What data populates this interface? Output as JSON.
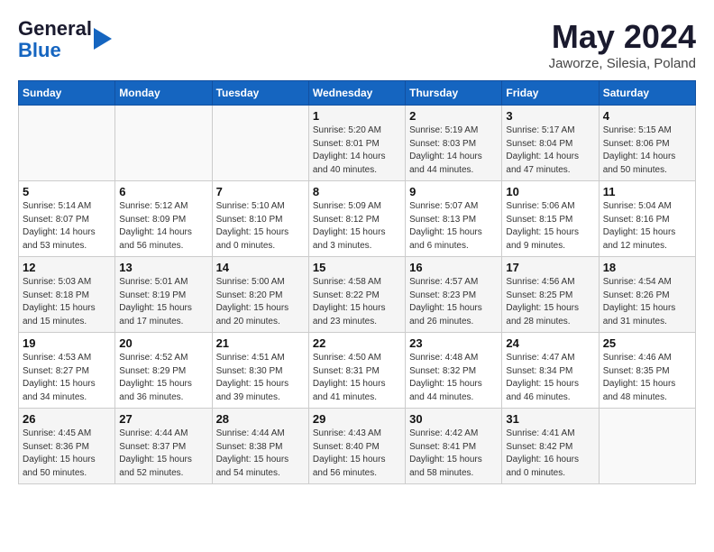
{
  "header": {
    "logo_general": "General",
    "logo_blue": "Blue",
    "month_year": "May 2024",
    "location": "Jaworze, Silesia, Poland"
  },
  "days_of_week": [
    "Sunday",
    "Monday",
    "Tuesday",
    "Wednesday",
    "Thursday",
    "Friday",
    "Saturday"
  ],
  "weeks": [
    [
      {
        "day": "",
        "info": ""
      },
      {
        "day": "",
        "info": ""
      },
      {
        "day": "",
        "info": ""
      },
      {
        "day": "1",
        "info": "Sunrise: 5:20 AM\nSunset: 8:01 PM\nDaylight: 14 hours\nand 40 minutes."
      },
      {
        "day": "2",
        "info": "Sunrise: 5:19 AM\nSunset: 8:03 PM\nDaylight: 14 hours\nand 44 minutes."
      },
      {
        "day": "3",
        "info": "Sunrise: 5:17 AM\nSunset: 8:04 PM\nDaylight: 14 hours\nand 47 minutes."
      },
      {
        "day": "4",
        "info": "Sunrise: 5:15 AM\nSunset: 8:06 PM\nDaylight: 14 hours\nand 50 minutes."
      }
    ],
    [
      {
        "day": "5",
        "info": "Sunrise: 5:14 AM\nSunset: 8:07 PM\nDaylight: 14 hours\nand 53 minutes."
      },
      {
        "day": "6",
        "info": "Sunrise: 5:12 AM\nSunset: 8:09 PM\nDaylight: 14 hours\nand 56 minutes."
      },
      {
        "day": "7",
        "info": "Sunrise: 5:10 AM\nSunset: 8:10 PM\nDaylight: 15 hours\nand 0 minutes."
      },
      {
        "day": "8",
        "info": "Sunrise: 5:09 AM\nSunset: 8:12 PM\nDaylight: 15 hours\nand 3 minutes."
      },
      {
        "day": "9",
        "info": "Sunrise: 5:07 AM\nSunset: 8:13 PM\nDaylight: 15 hours\nand 6 minutes."
      },
      {
        "day": "10",
        "info": "Sunrise: 5:06 AM\nSunset: 8:15 PM\nDaylight: 15 hours\nand 9 minutes."
      },
      {
        "day": "11",
        "info": "Sunrise: 5:04 AM\nSunset: 8:16 PM\nDaylight: 15 hours\nand 12 minutes."
      }
    ],
    [
      {
        "day": "12",
        "info": "Sunrise: 5:03 AM\nSunset: 8:18 PM\nDaylight: 15 hours\nand 15 minutes."
      },
      {
        "day": "13",
        "info": "Sunrise: 5:01 AM\nSunset: 8:19 PM\nDaylight: 15 hours\nand 17 minutes."
      },
      {
        "day": "14",
        "info": "Sunrise: 5:00 AM\nSunset: 8:20 PM\nDaylight: 15 hours\nand 20 minutes."
      },
      {
        "day": "15",
        "info": "Sunrise: 4:58 AM\nSunset: 8:22 PM\nDaylight: 15 hours\nand 23 minutes."
      },
      {
        "day": "16",
        "info": "Sunrise: 4:57 AM\nSunset: 8:23 PM\nDaylight: 15 hours\nand 26 minutes."
      },
      {
        "day": "17",
        "info": "Sunrise: 4:56 AM\nSunset: 8:25 PM\nDaylight: 15 hours\nand 28 minutes."
      },
      {
        "day": "18",
        "info": "Sunrise: 4:54 AM\nSunset: 8:26 PM\nDaylight: 15 hours\nand 31 minutes."
      }
    ],
    [
      {
        "day": "19",
        "info": "Sunrise: 4:53 AM\nSunset: 8:27 PM\nDaylight: 15 hours\nand 34 minutes."
      },
      {
        "day": "20",
        "info": "Sunrise: 4:52 AM\nSunset: 8:29 PM\nDaylight: 15 hours\nand 36 minutes."
      },
      {
        "day": "21",
        "info": "Sunrise: 4:51 AM\nSunset: 8:30 PM\nDaylight: 15 hours\nand 39 minutes."
      },
      {
        "day": "22",
        "info": "Sunrise: 4:50 AM\nSunset: 8:31 PM\nDaylight: 15 hours\nand 41 minutes."
      },
      {
        "day": "23",
        "info": "Sunrise: 4:48 AM\nSunset: 8:32 PM\nDaylight: 15 hours\nand 44 minutes."
      },
      {
        "day": "24",
        "info": "Sunrise: 4:47 AM\nSunset: 8:34 PM\nDaylight: 15 hours\nand 46 minutes."
      },
      {
        "day": "25",
        "info": "Sunrise: 4:46 AM\nSunset: 8:35 PM\nDaylight: 15 hours\nand 48 minutes."
      }
    ],
    [
      {
        "day": "26",
        "info": "Sunrise: 4:45 AM\nSunset: 8:36 PM\nDaylight: 15 hours\nand 50 minutes."
      },
      {
        "day": "27",
        "info": "Sunrise: 4:44 AM\nSunset: 8:37 PM\nDaylight: 15 hours\nand 52 minutes."
      },
      {
        "day": "28",
        "info": "Sunrise: 4:44 AM\nSunset: 8:38 PM\nDaylight: 15 hours\nand 54 minutes."
      },
      {
        "day": "29",
        "info": "Sunrise: 4:43 AM\nSunset: 8:40 PM\nDaylight: 15 hours\nand 56 minutes."
      },
      {
        "day": "30",
        "info": "Sunrise: 4:42 AM\nSunset: 8:41 PM\nDaylight: 15 hours\nand 58 minutes."
      },
      {
        "day": "31",
        "info": "Sunrise: 4:41 AM\nSunset: 8:42 PM\nDaylight: 16 hours\nand 0 minutes."
      },
      {
        "day": "",
        "info": ""
      }
    ]
  ]
}
